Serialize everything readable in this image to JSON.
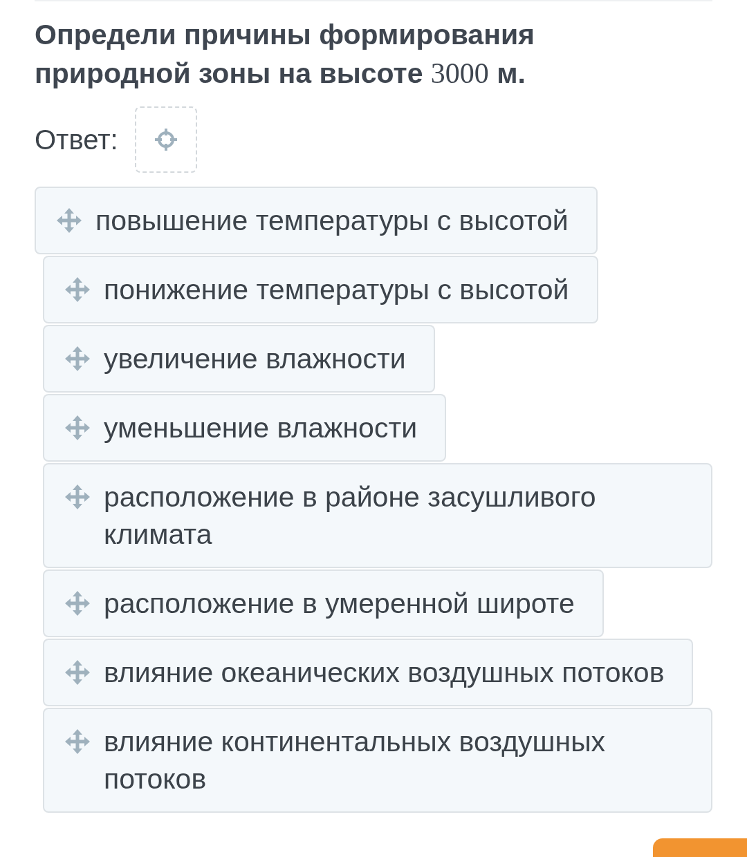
{
  "question": {
    "text": "Определи причины формирования природной зоны на высоте",
    "number": "3000",
    "unit": "м."
  },
  "answer": {
    "label": "Ответ:"
  },
  "options": [
    {
      "text": "повышение температуры с высотой"
    },
    {
      "text": "понижение температуры с высотой"
    },
    {
      "text": "увеличение влажности"
    },
    {
      "text": "уменьшение влажности"
    },
    {
      "text": "расположение в районе засушливого климата"
    },
    {
      "text": "расположение в умеренной широте"
    },
    {
      "text": "влияние океанических воздушных потоков"
    },
    {
      "text": "влияние континентальных воздушных потоков"
    }
  ]
}
